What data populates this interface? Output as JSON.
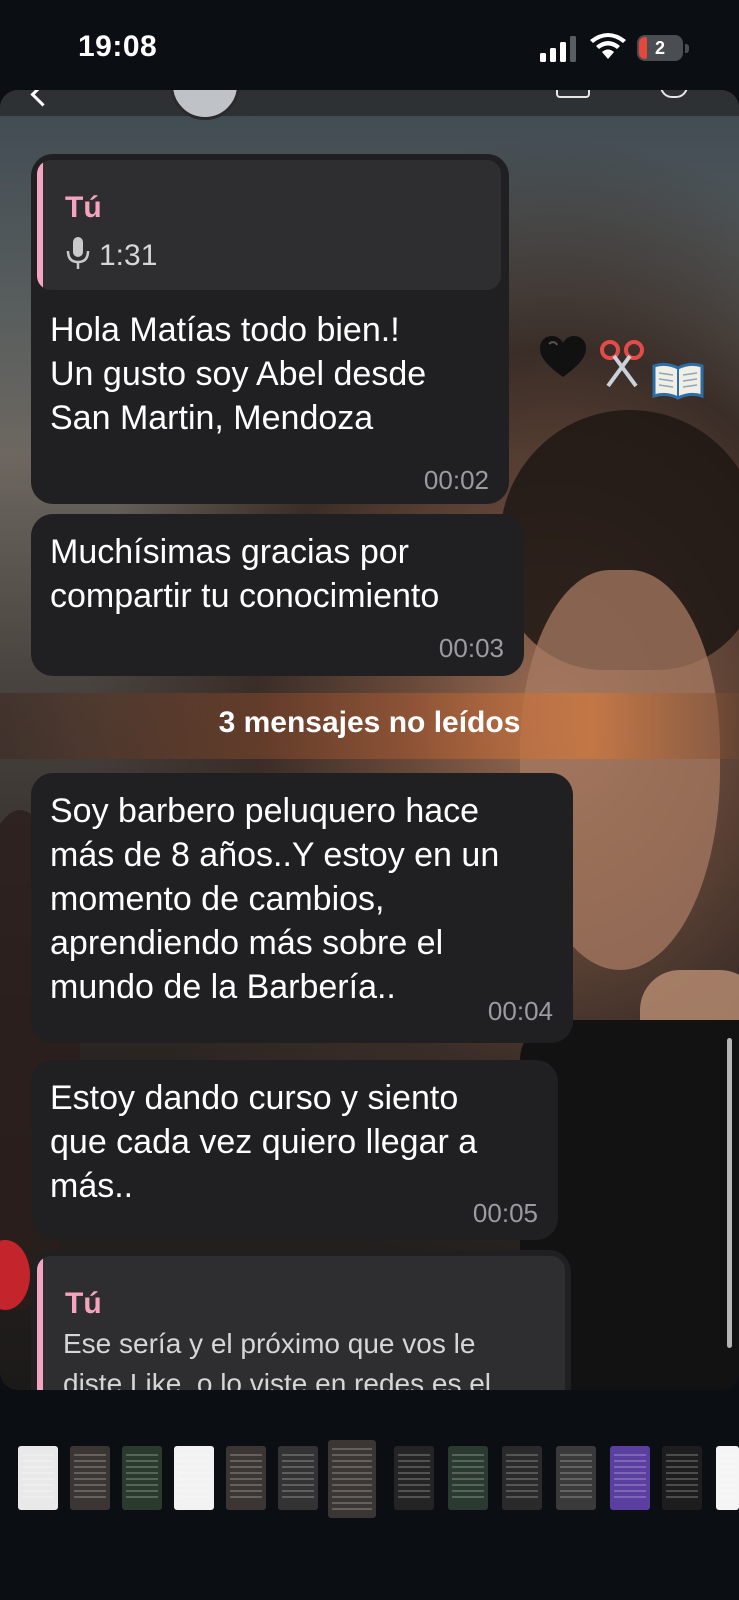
{
  "status_bar": {
    "time": "19:08",
    "battery_level": "2"
  },
  "messages": [
    {
      "reply_author": "Tú",
      "reply_duration": "1:31",
      "lines": [
        "Hola Matías todo bien.!",
        "Un gusto soy Abel desde",
        "San Martin, Mendoza"
      ],
      "time": "00:02"
    },
    {
      "lines": [
        "Muchísimas gracias por",
        "compartir tu conocimiento"
      ],
      "time": "00:03"
    },
    {
      "lines": [
        "Soy barbero peluquero hace",
        "más de 8 años..Y estoy en un",
        "momento de cambios,",
        "aprendiendo más sobre el",
        "mundo de la Barbería.."
      ],
      "time": "00:04"
    },
    {
      "lines": [
        "Estoy dando curso y siento",
        "que cada vez quiero llegar a",
        "más.."
      ],
      "time": "00:05"
    },
    {
      "reply_author": "Tú",
      "reply_lines": [
        "Ese sería y el próximo que vos le",
        "diste Like, o lo viste en redes es el"
      ]
    }
  ],
  "unread_divider": "3 mensajes no leídos",
  "colors": {
    "bubble": "#202022",
    "reply_accent": "#f6a4bd",
    "timestamp": "#9b9ba0"
  },
  "icons": [
    "signal-icon",
    "wifi-icon",
    "battery-icon",
    "mic-icon",
    "black-heart-icon",
    "scissors-icon",
    "open-book-icon"
  ],
  "thumbnail_strip": {
    "count": 14,
    "selected_index": 6
  }
}
